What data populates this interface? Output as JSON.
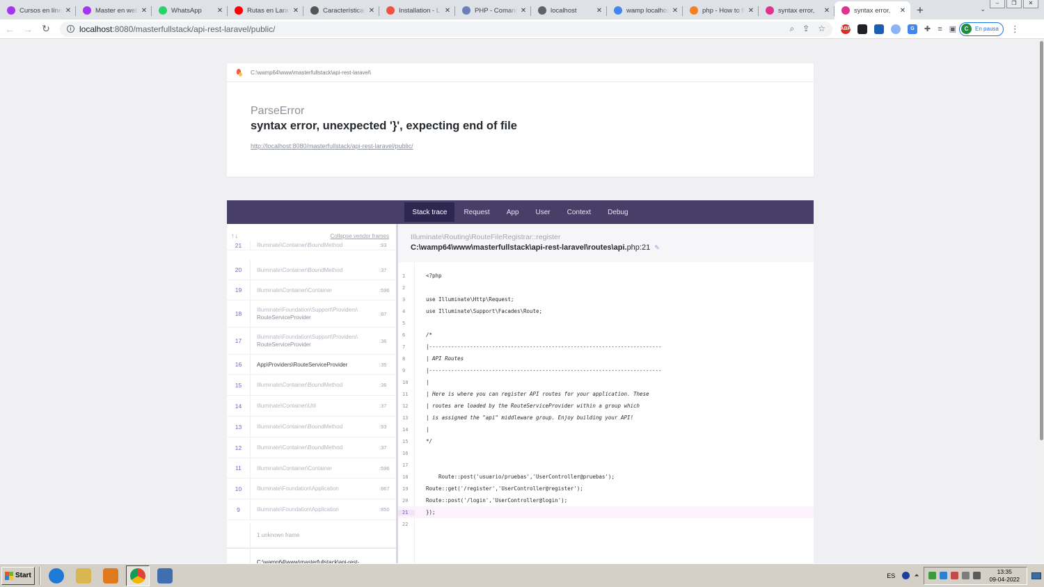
{
  "browser": {
    "tabs": [
      {
        "title": "Cursos en línea",
        "icon": "udemy-icon",
        "color": "#a435f0"
      },
      {
        "title": "Master en webs",
        "icon": "udemy-icon",
        "color": "#a435f0"
      },
      {
        "title": "WhatsApp",
        "icon": "whatsapp-icon",
        "color": "#25d366"
      },
      {
        "title": "Rutas en Laravel",
        "icon": "youtube-icon",
        "color": "#ff0000"
      },
      {
        "title": "Características",
        "icon": "gear-icon",
        "color": "#555555"
      },
      {
        "title": "Installation - Laravel",
        "icon": "laravel-icon",
        "color": "#f05340"
      },
      {
        "title": "PHP - Comandos",
        "icon": "doc-icon",
        "color": "#6a7fb5"
      },
      {
        "title": "localhost",
        "icon": "globe-icon",
        "color": "#5f6368"
      },
      {
        "title": "wamp localhost",
        "icon": "google-icon",
        "color": "#4285f4"
      },
      {
        "title": "php - How to fix",
        "icon": "stackoverflow-icon",
        "color": "#f48024"
      },
      {
        "title": "syntax error,",
        "icon": "ignition-icon",
        "color": "#e0338f"
      },
      {
        "title": "syntax error,",
        "icon": "ignition-icon",
        "color": "#e0338f",
        "active": true
      }
    ],
    "url_host": "localhost",
    "url_path": ":8080/masterfullstack/api-rest-laravel/public/",
    "profile_initial": "C",
    "profile_status": "En pausa"
  },
  "error": {
    "project_path": "C:\\wamp64\\www\\masterfullstack\\api-rest-laravel\\",
    "exception_class": "ParseError",
    "message": "syntax error, unexpected '}', expecting end of file",
    "url": "http://localhost:8080/masterfullstack/api-rest-laravel/public/"
  },
  "stack": {
    "tabs": [
      "Stack trace",
      "Request",
      "App",
      "User",
      "Context",
      "Debug"
    ],
    "active_tab": "Stack trace",
    "collapse_label": "Collapse vendor frames",
    "arrows": "↑↓",
    "frames": [
      {
        "num": "21",
        "cls": "Illuminate\\Container\\BoundMethod",
        "line": ":93"
      },
      {
        "num": "20",
        "cls": "Illuminate\\Container\\BoundMethod",
        "line": ":37"
      },
      {
        "num": "19",
        "cls": "Illuminate\\Container\\Container",
        "line": ":596"
      },
      {
        "num": "18",
        "cls": "Illuminate\\Foundation\\Support\\Providers\\",
        "cls2": "RouteServiceProvider",
        "line": ":87"
      },
      {
        "num": "17",
        "cls": "Illuminate\\Foundation\\Support\\Providers\\",
        "cls2": "RouteServiceProvider",
        "line": ":36"
      },
      {
        "num": "16",
        "cls": "App\\Providers\\RouteServiceProvider",
        "line": ":35"
      },
      {
        "num": "15",
        "cls": "Illuminate\\Container\\BoundMethod",
        "line": ":36"
      },
      {
        "num": "14",
        "cls": "Illuminate\\Container\\Util",
        "line": ":37"
      },
      {
        "num": "13",
        "cls": "Illuminate\\Container\\BoundMethod",
        "line": ":93"
      },
      {
        "num": "12",
        "cls": "Illuminate\\Container\\BoundMethod",
        "line": ":37"
      },
      {
        "num": "11",
        "cls": "Illuminate\\Container\\Container",
        "line": ":596"
      },
      {
        "num": "10",
        "cls": "Illuminate\\Foundation\\Application",
        "line": ":867"
      },
      {
        "num": "9",
        "cls": "Illuminate\\Foundation\\Application",
        "line": ":850"
      }
    ],
    "unknown_frame": "1 unknown frame",
    "app_frame_path": "C:\\wamp64\\www\\masterfullstack\\api-rest-",
    "selected_class": "Illuminate\\Routing\\RouteFileRegistrar::register",
    "selected_file": "C:\\wamp64\\www\\masterfullstack\\api-rest-laravel\\routes\\api.",
    "selected_file_ext": "php:21",
    "highlight_line": 21,
    "code": [
      {
        "n": "1",
        "t": "<?php",
        "k": "tag"
      },
      {
        "n": "2",
        "t": "",
        "k": ""
      },
      {
        "n": "3",
        "t": "use Illuminate\\Http\\Request;",
        "k": "use"
      },
      {
        "n": "4",
        "t": "use Illuminate\\Support\\Facades\\Route;",
        "k": "use"
      },
      {
        "n": "5",
        "t": "",
        "k": ""
      },
      {
        "n": "6",
        "t": "/*",
        "k": "cm"
      },
      {
        "n": "7",
        "t": "|--------------------------------------------------------------------------",
        "k": "cm"
      },
      {
        "n": "8",
        "t": "| API Routes",
        "k": "cm"
      },
      {
        "n": "9",
        "t": "|--------------------------------------------------------------------------",
        "k": "cm"
      },
      {
        "n": "10",
        "t": "|",
        "k": "cm"
      },
      {
        "n": "11",
        "t": "| Here is where you can register API routes for your application. These",
        "k": "cm"
      },
      {
        "n": "12",
        "t": "| routes are loaded by the RouteServiceProvider within a group which",
        "k": "cm"
      },
      {
        "n": "13",
        "t": "| is assigned the \"api\" middleware group. Enjoy building your API!",
        "k": "cm"
      },
      {
        "n": "14",
        "t": "|",
        "k": "cm"
      },
      {
        "n": "15",
        "t": "*/",
        "k": "cm"
      },
      {
        "n": "16",
        "t": "",
        "k": ""
      },
      {
        "n": "17",
        "t": "",
        "k": ""
      },
      {
        "n": "18",
        "t": "    Route::post('usuario/pruebas','UserController@pruebas');",
        "k": "code"
      },
      {
        "n": "19",
        "t": "Route::get('/register','UserController@register');",
        "k": "code"
      },
      {
        "n": "20",
        "t": "Route::post('/login','UserController@login');",
        "k": "code"
      },
      {
        "n": "21",
        "t": "});",
        "k": "code"
      },
      {
        "n": "22",
        "t": "",
        "k": ""
      }
    ]
  },
  "taskbar": {
    "start_label": "Start",
    "apps": [
      {
        "name": "ie-icon",
        "color": "#1f7ad6"
      },
      {
        "name": "explorer-icon",
        "color": "#d9b650"
      },
      {
        "name": "media-player-icon",
        "color": "#e07a1f"
      },
      {
        "name": "chrome-icon",
        "color": "#db4437",
        "pressed": true
      },
      {
        "name": "virtualbox-icon",
        "color": "#3f6fb0"
      }
    ],
    "language": "ES",
    "time": "13:35",
    "date": "09-04-2022"
  }
}
